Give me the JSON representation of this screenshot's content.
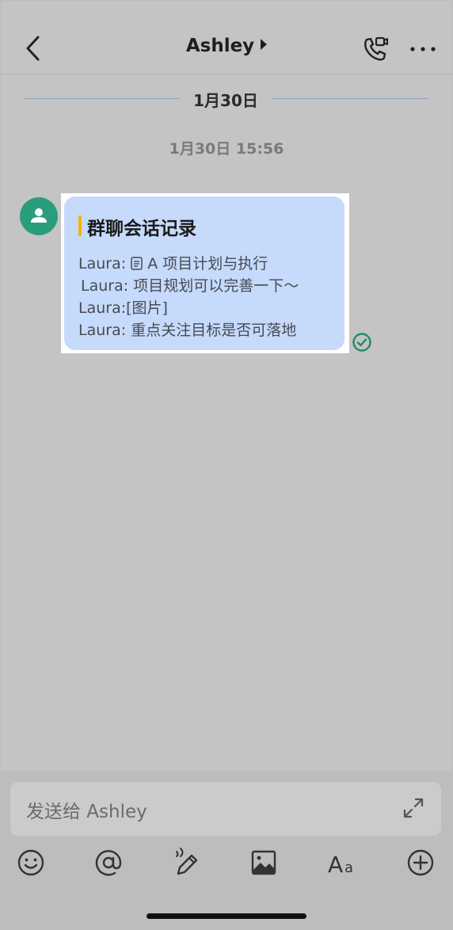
{
  "header": {
    "title": "Ashley",
    "back_icon": "chevron-left-icon",
    "call_icon": "phone-call-icon",
    "more_icon": "more-horizontal-icon"
  },
  "conversation": {
    "date_divider": "1月30日",
    "timestamp": "1月30日 15:56"
  },
  "message": {
    "heading": "群聊会话记录",
    "lines": [
      {
        "sender": "Laura:",
        "text": "A 项目计划与执行",
        "icon": "document-icon"
      },
      {
        "sender": "Laura:",
        "text": "项目规划可以完善一下～"
      },
      {
        "sender": "Laura:",
        "text": "[图片]"
      },
      {
        "sender": "Laura:",
        "text": "重点关注目标是否可落地"
      }
    ],
    "read_status_icon": "read-check-icon",
    "colors": {
      "bubble": "#c6dafc",
      "accent_bar": "#f5b400",
      "avatar": "#2a9d7d"
    }
  },
  "composer": {
    "placeholder": "发送给 Ashley",
    "expand_icon": "expand-icon",
    "toolbar": [
      "emoji-icon",
      "mention-icon",
      "voice-edit-icon",
      "image-icon",
      "text-format-icon",
      "add-icon"
    ]
  }
}
